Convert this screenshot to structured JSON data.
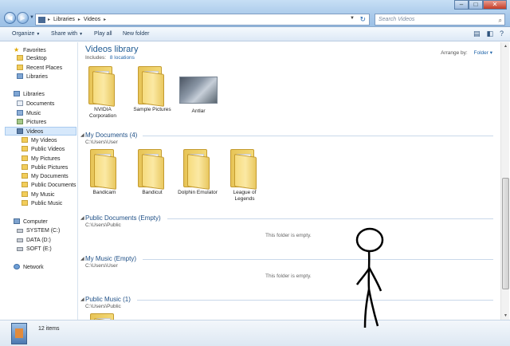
{
  "window": {
    "breadcrumb": [
      "Libraries",
      "Videos"
    ],
    "search_placeholder": "Search Videos",
    "controls": {
      "minimize": "–",
      "maximize": "□",
      "close": "✕"
    }
  },
  "toolbar": {
    "organize": "Organize",
    "share_with": "Share with",
    "play_all": "Play all",
    "new_folder": "New folder",
    "icons": [
      "view-options-icon",
      "preview-pane-icon",
      "help-icon"
    ]
  },
  "sidebar": {
    "favorites": {
      "label": "Favorites",
      "items": [
        "Desktop",
        "Recent Places",
        "Libraries"
      ]
    },
    "libraries": {
      "label": "Libraries",
      "items": [
        "Documents",
        "Music",
        "Pictures",
        "Videos"
      ],
      "videos_children": [
        "My Videos",
        "Public Videos",
        "My Pictures",
        "Public Pictures",
        "My Documents",
        "Public Documents",
        "My Music",
        "Public Music"
      ]
    },
    "computer": {
      "label": "Computer",
      "drives": [
        "SYSTEM (C:)",
        "DATA (D:)",
        "SOFT (E:)"
      ]
    },
    "network": "Network"
  },
  "main": {
    "title": "Videos library",
    "includes_label": "Includes:",
    "includes_link": "8 locations",
    "arrange_label": "Arrange by:",
    "arrange_value": "Folder",
    "top_items": [
      "NVIDIA Corporation",
      "Sample Pictures",
      "Antlar"
    ],
    "groups": [
      {
        "title": "My Documents (4)",
        "path": "C:\\Users\\User",
        "items": [
          "Bandicam",
          "Bandicut",
          "Dolphin Emulator",
          "League of Legends"
        ]
      },
      {
        "title": "Public Documents (Empty)",
        "path": "C:\\Users\\Public",
        "empty": "This folder is empty."
      },
      {
        "title": "My Music (Empty)",
        "path": "C:\\Users\\User",
        "empty": "This folder is empty."
      },
      {
        "title": "Public Music (1)",
        "path": "C:\\Users\\Public"
      }
    ]
  },
  "status": {
    "count": "12 items"
  },
  "colors": {
    "accent": "#1e5a92",
    "link": "#2266aa",
    "folder": "#f3d977"
  }
}
